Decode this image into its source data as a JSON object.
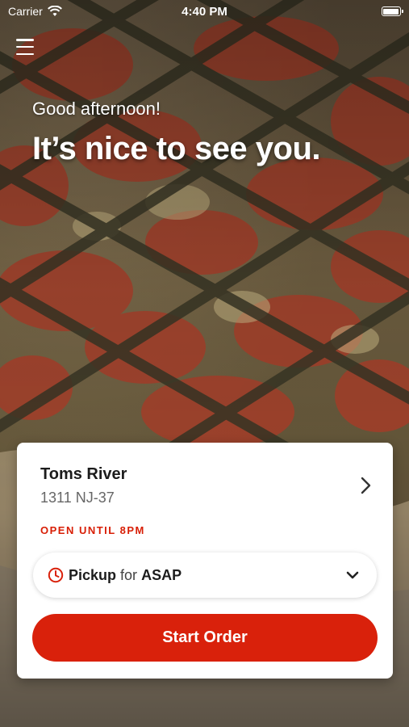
{
  "status_bar": {
    "carrier": "Carrier",
    "time": "4:40 PM"
  },
  "header": {
    "greeting": "Good afternoon!",
    "headline": "It’s nice to see you."
  },
  "location_card": {
    "store_name": "Toms River",
    "store_address": "1311 NJ-37",
    "store_status": "OPEN UNTIL 8PM",
    "pickup": {
      "mode_label": "Pickup",
      "connector": "for",
      "time_label": "ASAP"
    },
    "start_order_label": "Start Order"
  },
  "colors": {
    "accent": "#d9210b",
    "status_red": "#d81e05"
  },
  "icons": [
    "menu-icon",
    "wifi-icon",
    "battery-icon",
    "chevron-right-icon",
    "clock-icon",
    "chevron-down-icon"
  ]
}
